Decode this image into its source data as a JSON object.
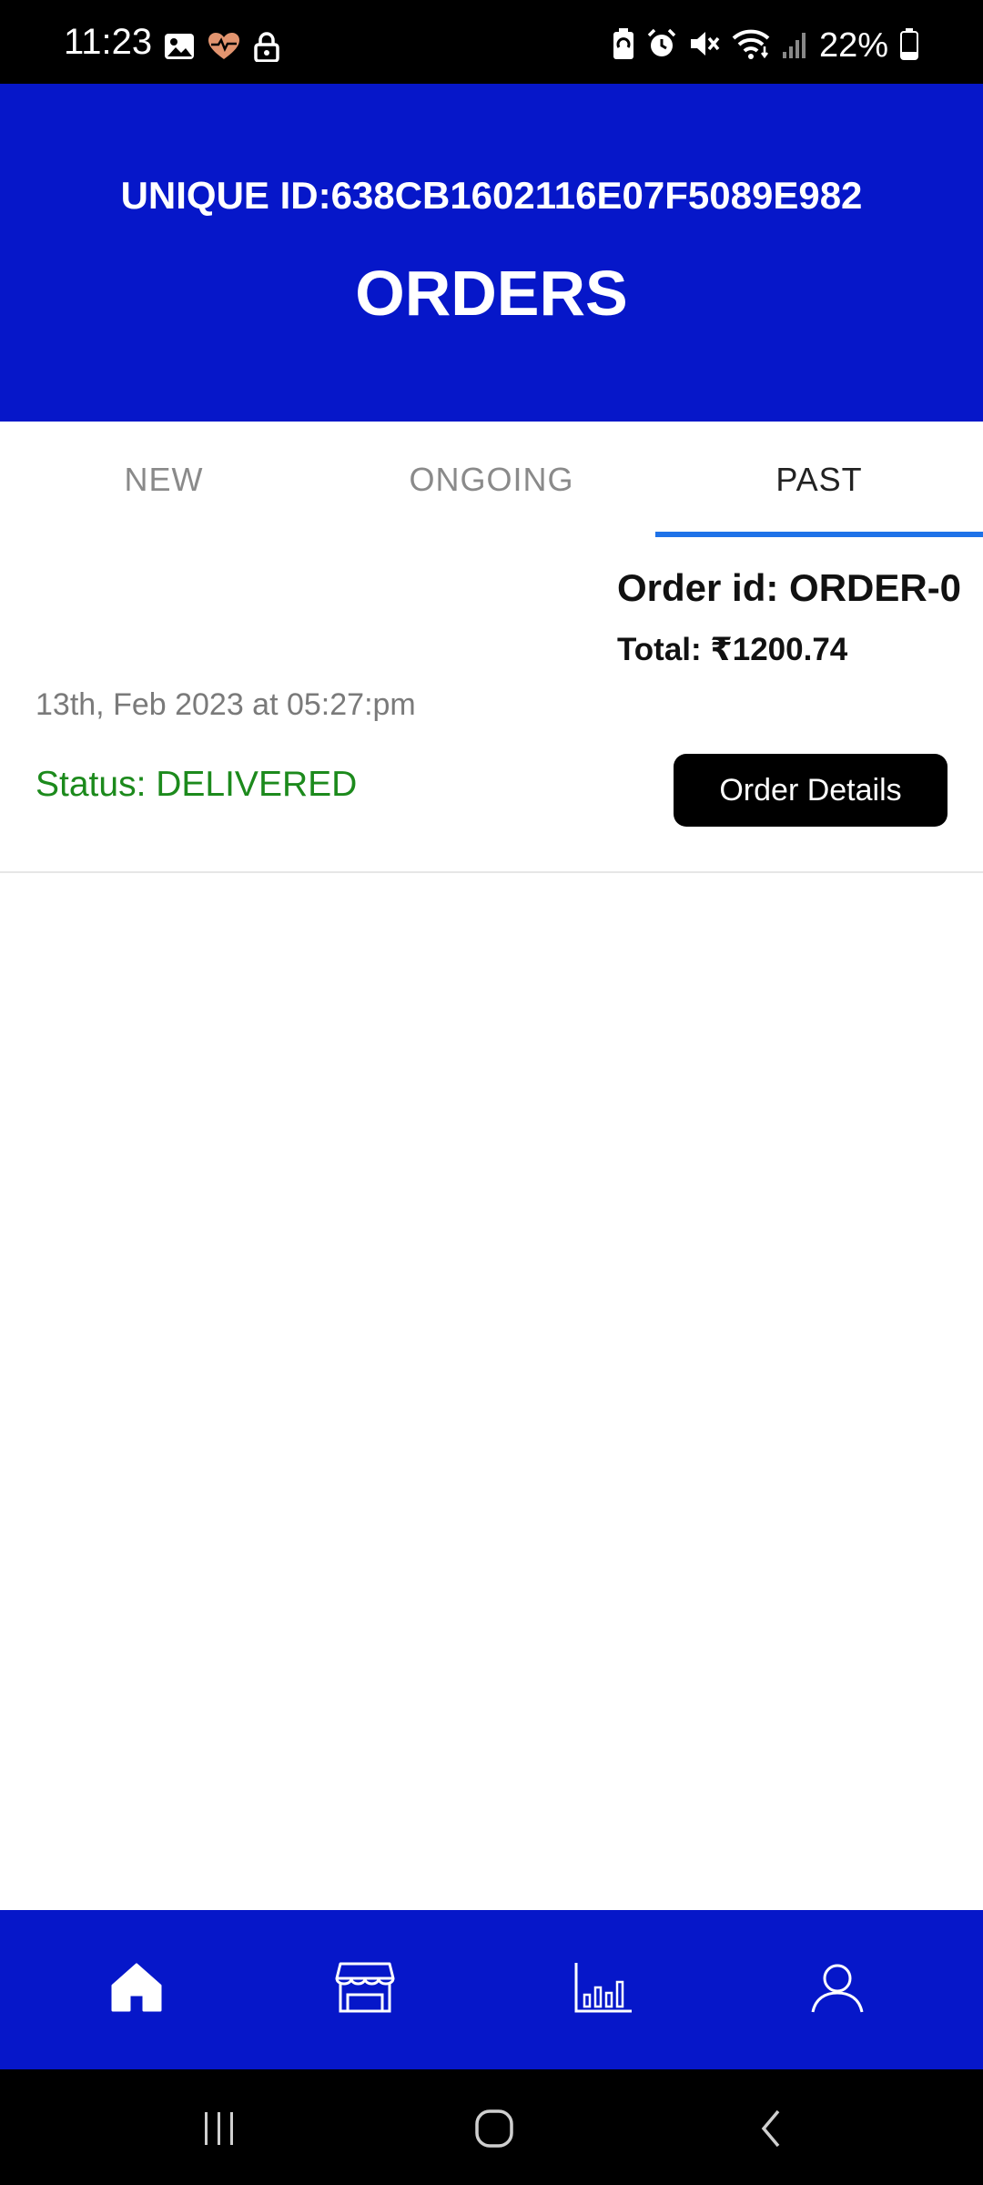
{
  "status_bar": {
    "time": "11:23",
    "battery": "22%",
    "left_icons": [
      "image-icon",
      "heart-pulse-icon",
      "lock-icon"
    ],
    "right_icons": [
      "battery-saver-icon",
      "alarm-icon",
      "mute-icon",
      "wifi-icon",
      "signal-icon",
      "battery-icon"
    ]
  },
  "header": {
    "unique_id": "UNIQUE ID:638CB1602116E07F5089E982",
    "title": "ORDERS",
    "background_color": "#0617c9"
  },
  "tabs": [
    {
      "label": "NEW",
      "active": false
    },
    {
      "label": "ONGOING",
      "active": false
    },
    {
      "label": "PAST",
      "active": true
    }
  ],
  "orders": [
    {
      "order_id": "Order id: ORDER-0",
      "total": "Total: ₹1200.74",
      "date": "13th, Feb 2023 at 05:27:pm",
      "status": "Status: DELIVERED",
      "status_color": "#1c8a1c",
      "details_button": "Order Details"
    }
  ],
  "bottom_nav": {
    "items": [
      "home-icon",
      "store-icon",
      "chart-icon",
      "profile-icon"
    ],
    "active": "home-icon"
  },
  "system_nav": {
    "items": [
      "recents-icon",
      "home-circle-icon",
      "back-icon"
    ]
  }
}
